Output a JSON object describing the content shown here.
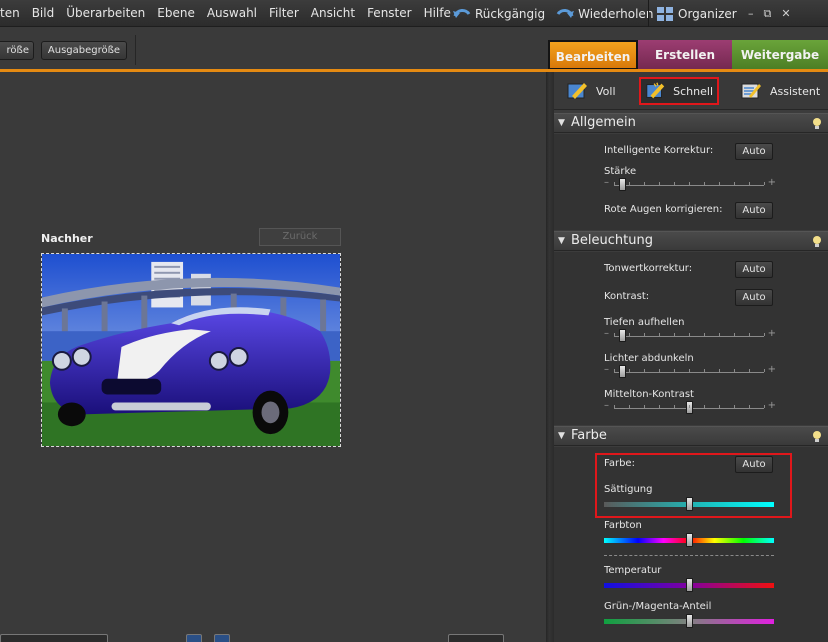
{
  "menubar": {
    "items": [
      "ten",
      "Bild",
      "Überarbeiten",
      "Ebene",
      "Auswahl",
      "Filter",
      "Ansicht",
      "Fenster",
      "Hilfe"
    ],
    "undo_label": "Rückgängig",
    "redo_label": "Wiederholen",
    "organizer_label": "Organizer",
    "minimize_glyph": "–",
    "restore_glyph": "⧉",
    "close_glyph": "✕"
  },
  "toolbar": {
    "image_size_label": "röße",
    "output_size_label": "Ausgabegröße"
  },
  "mode_tabs": {
    "edit": "Bearbeiten",
    "create": "Erstellen",
    "share": "Weitergabe"
  },
  "canvas": {
    "after_label": "Nachher",
    "back_button": "Zurück"
  },
  "panel": {
    "subtabs": {
      "full": "Voll",
      "quick": "Schnell",
      "guided": "Assistent"
    },
    "sections": {
      "general": {
        "title": "Allgemein",
        "smart_fix_label": "Intelligente Korrektur:",
        "smart_fix_button": "Auto",
        "strength_label": "Stärke",
        "strength_value": 0.05,
        "red_eye_label": "Rote Augen korrigieren:",
        "red_eye_button": "Auto"
      },
      "lighting": {
        "title": "Beleuchtung",
        "levels_label": "Tonwertkorrektur:",
        "levels_button": "Auto",
        "contrast_label": "Kontrast:",
        "contrast_button": "Auto",
        "shadows_label": "Tiefen aufhellen",
        "shadows_value": 0.05,
        "highlights_label": "Lichter abdunkeln",
        "highlights_value": 0.05,
        "midtone_label": "Mittelton-Kontrast",
        "midtone_value": 0.5
      },
      "color": {
        "title": "Farbe",
        "color_label": "Farbe:",
        "color_button": "Auto",
        "saturation_label": "Sättigung",
        "saturation_value": 0.5,
        "hue_label": "Farbton",
        "hue_value": 0.5,
        "temperature_label": "Temperatur",
        "temperature_value": 0.5,
        "tint_label": "Grün-/Magenta-Anteil",
        "tint_value": 0.5
      }
    }
  },
  "colors": {
    "accent_orange": "#e58a12",
    "highlight_red": "#e0171b",
    "create_purple": "#8a3463",
    "share_green": "#5a912f"
  }
}
